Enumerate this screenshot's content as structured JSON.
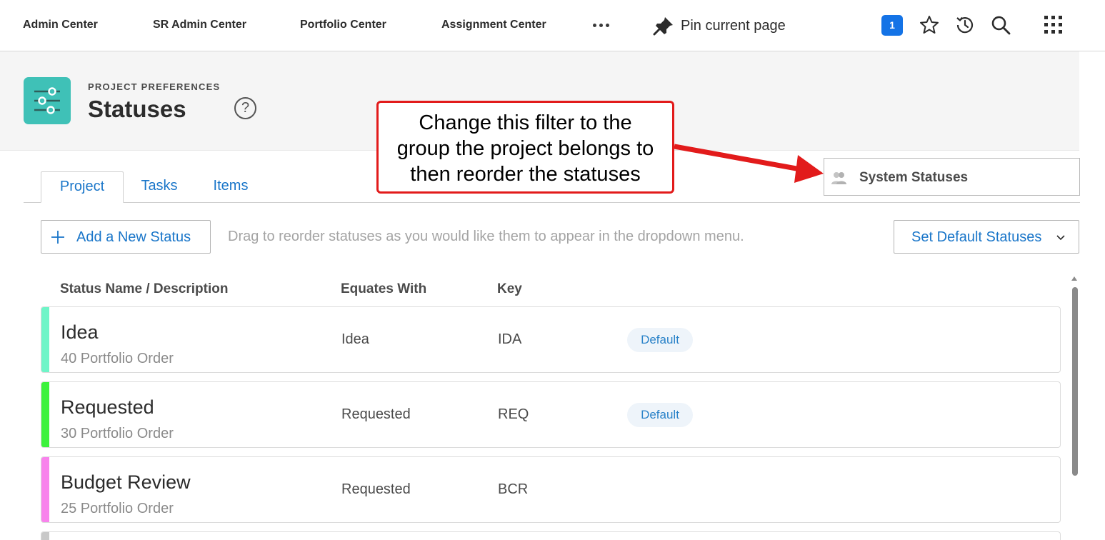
{
  "topnav": {
    "links": [
      "Admin Center",
      "SR Admin Center",
      "Portfolio Center",
      "Assignment Center"
    ],
    "more_icon": "more-horizontal-icon",
    "pin_label": "Pin current page",
    "notification_count": "1",
    "icons": [
      "star-icon",
      "history-icon",
      "search-icon",
      "apps-grid-icon"
    ],
    "accent": "#1473e6"
  },
  "header": {
    "overline": "PROJECT PREFERENCES",
    "title": "Statuses",
    "help": "?",
    "icon": "sliders-icon",
    "icon_color": "#3fc1b7"
  },
  "tabs": [
    {
      "label": "Project",
      "active": true
    },
    {
      "label": "Tasks",
      "active": false
    },
    {
      "label": "Items",
      "active": false
    }
  ],
  "annotation": {
    "lines": [
      "Change this filter to the",
      "group the project belongs to",
      "then reorder the statuses"
    ],
    "color": "#e21b1b"
  },
  "filter": {
    "label": "System Statuses",
    "icon": "group-icon"
  },
  "toolbar": {
    "add_label": "Add a New Status",
    "hint": "Drag to reorder statuses as you would like them to appear in the dropdown menu.",
    "default_label": "Set Default Statuses"
  },
  "table": {
    "headers": [
      "Status Name / Description",
      "Equates With",
      "Key"
    ],
    "rows": [
      {
        "name": "Idea",
        "desc": "40 Portfolio Order",
        "equates": "Idea",
        "key": "IDA",
        "badge": "Default",
        "color": "#6ff5c8"
      },
      {
        "name": "Requested",
        "desc": "30 Portfolio Order",
        "equates": "Requested",
        "key": "REQ",
        "badge": "Default",
        "color": "#3cf23c"
      },
      {
        "name": "Budget Review",
        "desc": "25 Portfolio Order",
        "equates": "Requested",
        "key": "BCR",
        "badge": "",
        "color": "#f883ec"
      }
    ],
    "partial_row_color": "#c8c8c8"
  }
}
